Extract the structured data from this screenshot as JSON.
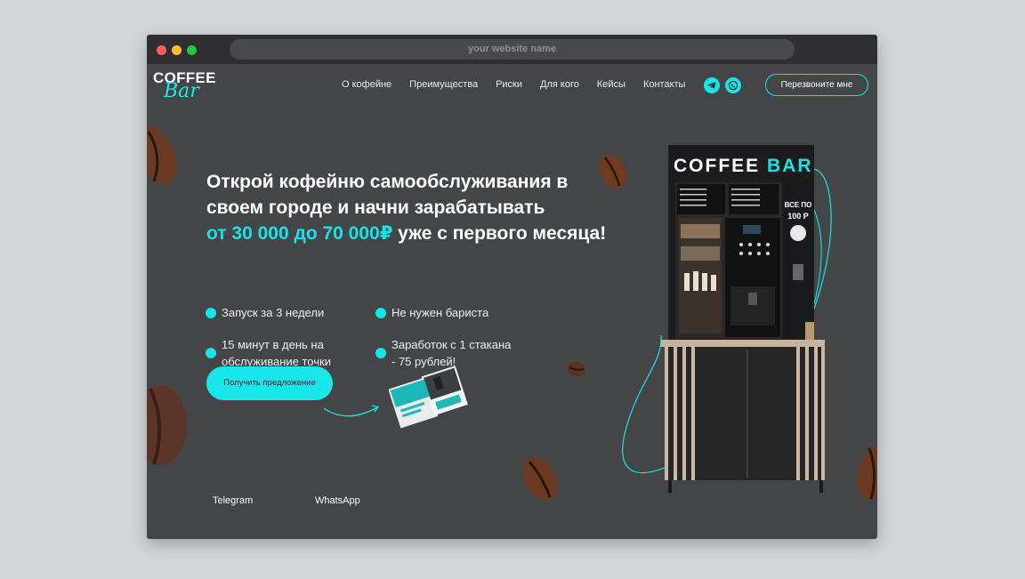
{
  "browser": {
    "url_placeholder": "your website name"
  },
  "logo": {
    "line1": "COFFEE",
    "line2": "Bar"
  },
  "nav": {
    "items": [
      "О кофейне",
      "Преимущества",
      "Риски",
      "Для кого",
      "Кейсы",
      "Контакты"
    ],
    "callback_label": "Перезвоните мне"
  },
  "hero": {
    "title_line1": "Открой кофейню самообслуживания в",
    "title_line2": "своем городе и начни зарабатывать",
    "title_accent": "от 30 000 до 70 000₽",
    "title_tail": " уже с первого месяца!",
    "features": [
      {
        "line1": "Запуск за 3 недели",
        "line2": ""
      },
      {
        "line1": "Не нужен бариста",
        "line2": ""
      },
      {
        "line1": "15 минут в день на",
        "line2": "обслуживание точки"
      },
      {
        "line1": "Заработок с 1 стакана",
        "line2": "- 75 рублей!"
      }
    ],
    "cta_label": "Получить предложение"
  },
  "links": {
    "telegram": "Telegram",
    "whatsapp": "WhatsApp"
  },
  "kiosk": {
    "sign_left": "COFFEE ",
    "sign_right": "BAR",
    "price_line1": "ВСЕ ПО",
    "price_line2": "100 Р"
  },
  "colors": {
    "accent": "#16e4e8",
    "background": "#444546",
    "titlebar": "#2e2e33"
  },
  "icons": [
    "telegram-icon",
    "whatsapp-icon",
    "coffee-bean-icon",
    "arrow-icon"
  ]
}
